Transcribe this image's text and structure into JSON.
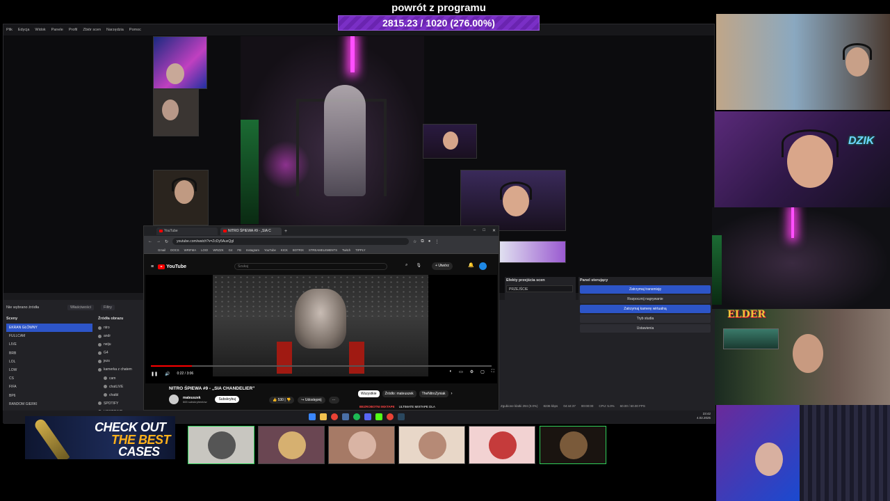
{
  "goal": {
    "title": "powrót z programu",
    "progress_text": "2815.23 / 1020 (276.00%)",
    "progress_fraction": 2.76
  },
  "obs": {
    "menu": [
      "Plik",
      "Edycja",
      "Widok",
      "Panele",
      "Profil",
      "Zbiór scen",
      "Narzędzia",
      "Pomoc"
    ],
    "no_source_label": "Nie wybrano źródła",
    "properties_label": "Właściwości",
    "filters_label": "Filtry",
    "scenes_title": "Sceny",
    "sources_title": "Źródła obrazu",
    "scenes": [
      "EKRAN GŁÓWNY",
      "FULLCAM",
      "LIVE",
      "BRB",
      "LOL",
      "LOW",
      "CS",
      "FIFA",
      "BP6",
      "RANDOM GIERKI",
      "START"
    ],
    "active_scene_index": 0,
    "sources": [
      "ntro",
      "andr",
      "neiju",
      "G4",
      "jezs",
      "kamerka z chatem",
      "cam",
      "chatLIVE",
      "chatbl",
      "SPOTIFY",
      "HOST/RAID"
    ],
    "transitions_title": "Efekty przejścia scen",
    "transition_value": "PRZEJŚCIE",
    "controls_title": "Panel sterujący",
    "controls": [
      {
        "label": "Zatrzymaj transmisję",
        "active": true
      },
      {
        "label": "Rozpocznij nagrywanie",
        "active": false
      },
      {
        "label": "Zatrzymaj kamerę wirtualną",
        "active": true
      },
      {
        "label": "Tryb studia",
        "active": false
      },
      {
        "label": "Ustawienia",
        "active": false
      }
    ],
    "status": [
      "Zgubione klatki 294 (0.0%)",
      "8236 kbps",
      "04:44:37",
      "00:00:00",
      "CPU: 5.0%",
      "60.00 / 60.00 FPS"
    ]
  },
  "browser": {
    "tabs": [
      {
        "label": "YouTube",
        "active": false
      },
      {
        "label": "NITRO ŚPIEWA #9 - „SIA C",
        "active": true
      }
    ],
    "url": "youtube.com/watch?v=ZcDy5AuxQgI",
    "bookmarks": [
      "Gmail",
      "DOCS",
      "WRIFMA",
      "LOG!",
      "WRZZK",
      "G4",
      "FB",
      "Instagram",
      "YouTube",
      "KICK",
      "BOTRIX",
      "STREAMELEMENTS",
      "Twitch",
      "TIPPLY"
    ],
    "search_placeholder": "Szukaj",
    "create_label": "Utwórz",
    "video": {
      "current_time": "0:22 / 3:06",
      "progress_fraction": 0.12,
      "title": "NITRO ŚPIEWA #9 - „SIA CHANDELIER”",
      "channel": "mateuszek",
      "subscribers": "665 subskrybentów",
      "subscribe_label": "Subskrybuj",
      "likes": "530",
      "share_label": "Udostępnij",
      "more_label": "···"
    },
    "chips": [
      "Wszystkie",
      "Źródło: mateuszek",
      "TheNitroZyniak"
    ],
    "active_chip_index": 0,
    "rec_prefix": "BEZROBOTNI MIXTAPE",
    "rec_title": "ULTIMATE MIXTAPE DLA"
  },
  "taskbar": {
    "time": "23:42",
    "date": "4.02.2025"
  },
  "banner": {
    "line1": "CHECK OUT",
    "line2": "THE BEST",
    "line3": "CASES"
  },
  "overlays": {
    "dzik_logo": "DZIK",
    "elder_logo": "ELDER"
  },
  "colors": {
    "accent_blue": "#2d55c8",
    "goal_purple": "#7a2fc6",
    "neon_pink": "#ff4fff",
    "tile_green": "#2fd05a"
  }
}
